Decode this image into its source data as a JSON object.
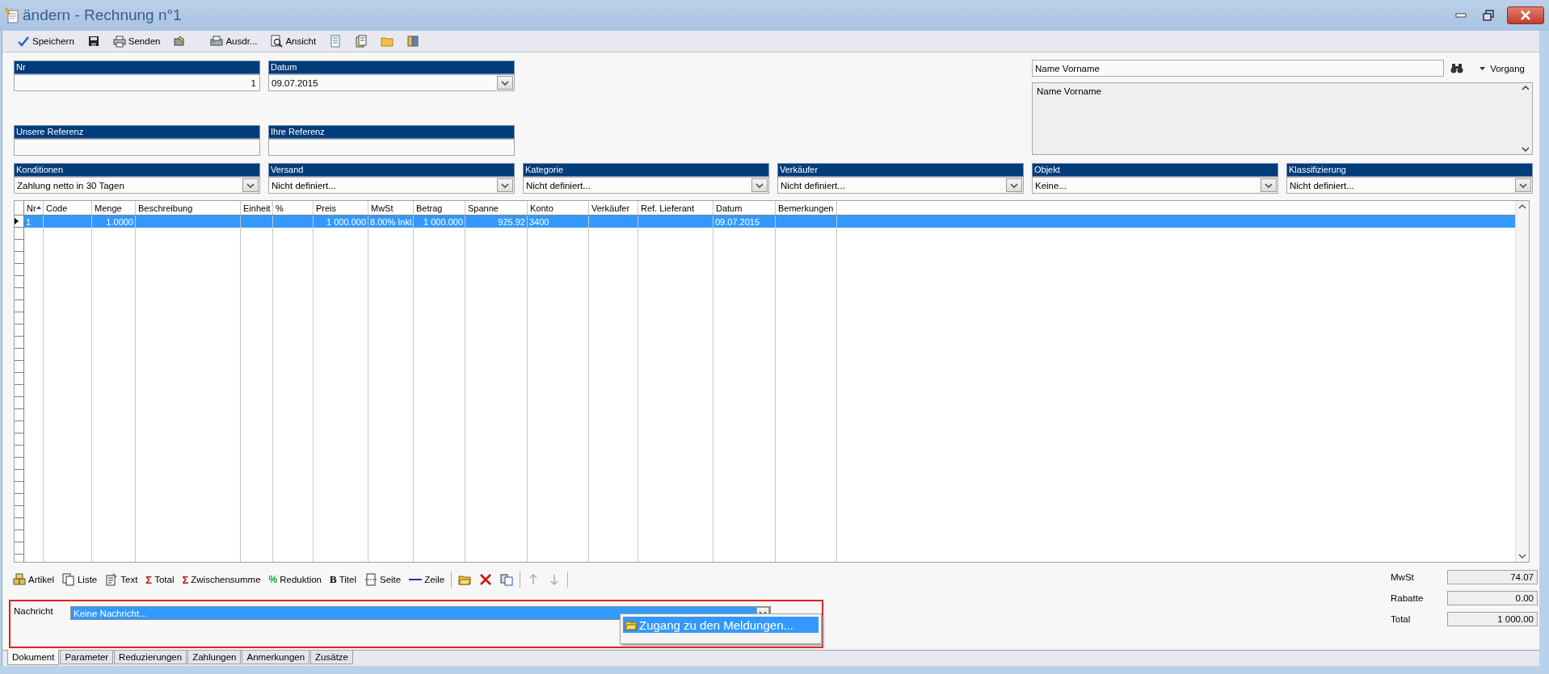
{
  "window": {
    "title": "ändern - Rechnung n°1"
  },
  "toolbar": [
    {
      "kind": "button",
      "label": "Speichern"
    },
    {
      "kind": "icon"
    },
    {
      "kind": "button",
      "label": "Senden"
    },
    {
      "kind": "icon"
    },
    {
      "kind": "button",
      "label": "Ausdr..."
    },
    {
      "kind": "button",
      "label": "Ansicht"
    },
    {
      "kind": "icon"
    },
    {
      "kind": "icon"
    },
    {
      "kind": "icon"
    },
    {
      "kind": "icon"
    }
  ],
  "fields": [
    {
      "label": "Nr",
      "value": "1",
      "kind": "number"
    },
    {
      "label": "Datum",
      "value": "09.07.2015",
      "kind": "dropdown"
    },
    {
      "label": "Unsere Referenz",
      "kind": "text"
    },
    {
      "label": "Ihre Referenz",
      "kind": "text"
    },
    {
      "label": "Konditionen",
      "value": "Zahlung netto in 30 Tagen",
      "kind": "dropdown"
    },
    {
      "label": "Versand",
      "value": "Nicht definiert...",
      "kind": "dropdown"
    },
    {
      "label": "Kategorie",
      "value": "Nicht definiert...",
      "kind": "dropdown"
    },
    {
      "label": "Verkäufer",
      "value": "Nicht definiert...",
      "kind": "dropdown"
    },
    {
      "label": "Objekt",
      "value": "Keine...",
      "kind": "dropdown"
    },
    {
      "label": "Klassifizierung",
      "value": "Nicht definiert...",
      "kind": "dropdown"
    }
  ],
  "customer": {
    "search_value": "Name Vorname",
    "menu": "Vorgang",
    "address": "Name Vorname"
  },
  "table": {
    "columns": [
      {
        "label": "Nr",
        "sorted": true
      },
      {
        "label": "Code",
        "sorted": false
      },
      {
        "label": "Menge",
        "sorted": false
      },
      {
        "label": "Beschreibung",
        "sorted": false
      },
      {
        "label": "Einheit",
        "sorted": false
      },
      {
        "label": "%",
        "sorted": false
      },
      {
        "label": "Preis",
        "sorted": false
      },
      {
        "label": "MwSt",
        "sorted": false
      },
      {
        "label": "Betrag",
        "sorted": false
      },
      {
        "label": "Spanne",
        "sorted": false
      },
      {
        "label": "Konto",
        "sorted": false
      },
      {
        "label": "Verkäufer",
        "sorted": false
      },
      {
        "label": "Ref. Lieferant",
        "sorted": false
      },
      {
        "label": "Datum",
        "sorted": false
      },
      {
        "label": "Bemerkungen",
        "sorted": false
      }
    ],
    "rows": [
      {
        "selected": true,
        "cells": [
          "1",
          null,
          "1.0000",
          null,
          null,
          null,
          "1 000.000",
          "8.00% Inkl.",
          "1 000.000",
          "925.92",
          "3400",
          null,
          null,
          "09.07.2015",
          null
        ]
      }
    ]
  },
  "lines_toolbar": [
    {
      "kind": "button",
      "label": "Artikel"
    },
    {
      "kind": "button",
      "label": "Liste"
    },
    {
      "kind": "button",
      "label": "Text"
    },
    {
      "kind": "button",
      "symbol": "Σ",
      "label": "Total"
    },
    {
      "kind": "button",
      "symbol": "Σ",
      "label": "Zwischensumme"
    },
    {
      "kind": "button",
      "symbol": "%",
      "label": "Reduktion"
    },
    {
      "kind": "button",
      "symbol": "B",
      "label": "Titel"
    },
    {
      "kind": "button",
      "label": "Seite"
    },
    {
      "kind": "button",
      "label": "Zeile"
    },
    {
      "kind": "icon"
    },
    {
      "kind": "icon"
    },
    {
      "kind": "icon"
    },
    {
      "kind": "icon",
      "disabled": true
    },
    {
      "kind": "icon",
      "disabled": true
    }
  ],
  "message": {
    "label": "Nachricht",
    "value": "Keine Nachricht...",
    "menu": [
      {
        "label": "Zugang zu den Meldungen...",
        "selected": true
      }
    ]
  },
  "totals": [
    {
      "label": "MwSt",
      "value": "74.07"
    },
    {
      "label": "Rabatte",
      "value": "0.00"
    },
    {
      "label": "Total",
      "value": "1 000.00"
    }
  ],
  "tabs": [
    {
      "label": "Dokument",
      "selected": true
    },
    {
      "label": "Parameter",
      "selected": false
    },
    {
      "label": "Reduzierungen",
      "selected": false
    },
    {
      "label": "Zahlungen",
      "selected": false
    },
    {
      "label": "Anmerkungen",
      "selected": false
    },
    {
      "label": "Zusätze",
      "selected": false
    }
  ]
}
